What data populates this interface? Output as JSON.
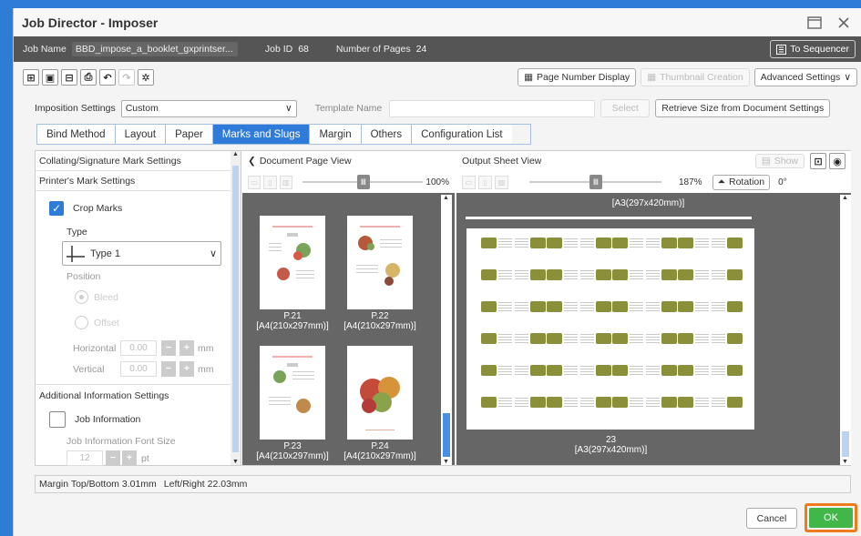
{
  "window": {
    "title": "Job Director - Imposer"
  },
  "jobbar": {
    "job_name_label": "Job Name",
    "job_name_value": "BBD_impose_a_booklet_gxprintser...",
    "job_id_label": "Job ID",
    "job_id_value": "68",
    "pages_label": "Number of Pages",
    "pages_value": "24",
    "to_sequencer": "To Sequencer"
  },
  "toolbar": {
    "page_number_display": "Page Number Display",
    "thumbnail_creation": "Thumbnail Creation",
    "advanced_settings": "Advanced Settings"
  },
  "settings": {
    "imposition_label": "Imposition Settings",
    "imposition_value": "Custom",
    "template_label": "Template Name",
    "select_label": "Select",
    "retrieve_label": "Retrieve Size from Document Settings"
  },
  "tabs": [
    {
      "label": "Bind Method"
    },
    {
      "label": "Layout"
    },
    {
      "label": "Paper"
    },
    {
      "label": "Marks and Slugs",
      "active": true
    },
    {
      "label": "Margin"
    },
    {
      "label": "Others"
    },
    {
      "label": "Configuration List"
    }
  ],
  "left_panel": {
    "collating": "Collating/Signature Mark Settings",
    "printers_mark": "Printer's Mark Settings",
    "crop_marks": "Crop Marks",
    "crop_marks_checked": true,
    "type_label": "Type",
    "type_value": "Type 1",
    "position_label": "Position",
    "bleed": "Bleed",
    "offset": "Offset",
    "horizontal": "Horizontal",
    "horizontal_value": "0.00",
    "vertical": "Vertical",
    "vertical_value": "0.00",
    "unit": "mm",
    "additional": "Additional Information Settings",
    "job_info": "Job Information",
    "job_info_checked": false,
    "font_size_label": "Job Information Font Size",
    "font_size_value": "12",
    "font_unit": "pt"
  },
  "doc_view": {
    "title": "Document Page View",
    "zoom": "100%",
    "pages": [
      {
        "num": "P.21",
        "size": "[A4(210x297mm)]"
      },
      {
        "num": "P.22",
        "size": "[A4(210x297mm)]"
      },
      {
        "num": "P.23",
        "size": "[A4(210x297mm)]"
      },
      {
        "num": "P.24",
        "size": "[A4(210x297mm)]"
      }
    ]
  },
  "out_view": {
    "title": "Output Sheet View",
    "show": "Show",
    "zoom": "187%",
    "rotation": "Rotation",
    "rotation_value": "0°",
    "top_label": "[A3(297x420mm)]",
    "sheet_num": "23",
    "sheet_size": "[A3(297x420mm)]"
  },
  "status": {
    "text1": "Margin  Top/Bottom  3.01mm",
    "text2": "Left/Right  22.03mm"
  },
  "footer": {
    "cancel": "Cancel",
    "ok": "OK"
  }
}
